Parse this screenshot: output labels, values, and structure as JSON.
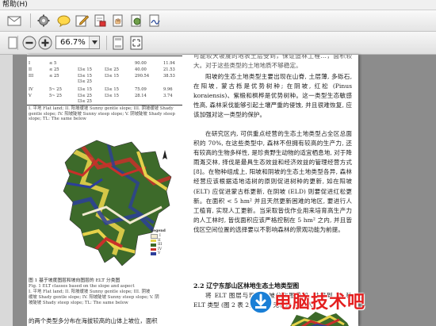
{
  "menubar": {
    "help_menu": "帮助(H)"
  },
  "toolbar": {
    "zoom_value": "66.7%",
    "icons": [
      "mail-icon",
      "settings-icon",
      "comment-icon",
      "edit-icon",
      "document-icon",
      "hand-icon",
      "scan-icon",
      "sign-icon",
      "zoom-out-icon",
      "zoom-in-icon",
      "single-page-icon",
      "fit-page-icon"
    ]
  },
  "document": {
    "table": {
      "rows": [
        [
          "I",
          "≤ 5",
          "",
          "",
          "",
          "",
          "90.00",
          "11.94"
        ],
        [
          "II",
          "≤ 25",
          "I3≤ 15",
          "I3≤ 25",
          "40.00",
          "21.53"
        ],
        [
          "III",
          "≤ 25",
          "I3≤ 15",
          "I3≤ 15",
          "290.54",
          "38.53"
        ],
        [
          "",
          "",
          "I3≤ 25",
          "",
          "",
          ""
        ],
        [
          "IV",
          "5~ 25",
          "I3≤ 15",
          "I3≤ 15",
          "75.09",
          "9.96"
        ],
        [
          "V",
          "5~ 25",
          "I3≤ 25",
          "I3≤ 15",
          "28.14",
          "3.74"
        ],
        [
          "",
          "",
          "I3≤ 25",
          "",
          "",
          ""
        ]
      ],
      "note": "I. 平地 Flat land; II. 阳坡缓坡 Sunny gentle slope; III. 阴坡缓坡 Shady gentle slope; IV. 阳坡陡坡 Sunny steep slope; V. 阴坡陡坡 Shady steep slope; TL: The same below"
    },
    "map_legend": {
      "title": "Legend",
      "items": [
        "I",
        "II",
        "III",
        "IV",
        "V"
      ]
    },
    "figure_caption": {
      "title": "图 1  基于坡度图层和坡向图层的 ELT 分类图",
      "en_title": "Fig. 1  ELT classes based on the slope and aspect",
      "lines": [
        "I. 平地 Flat land; II. 阳坡缓坡 Sunny gentle slope; III. 阴坡",
        "缓坡 Shady gentle slope; IV. 阳坡陡坡 Sunny steep slope; V. 阴",
        "坡陡坡 Shady steep slope; TL: The same below"
      ]
    },
    "left_bottom_text": "的两个类型多分布在海拔较高的山体上坡位，面积",
    "right_column": {
      "top_line": "可能较大坡度的地表土层受到，保证造林工程…，面积较大。对于这些类型的土地地质不够稳定。",
      "paragraph_1": "阳坡的生态土地类型主要出现在山脊, 土层薄, 多砾石, 在阳坡, 蒙古栎是优势树种; 在阴坡, 红松 (Pinus koraiensis)、紫椴和枫桦是优势树种。这一类型生态敏感性高, 森林采伐能够引起土壤严重的侵蚀, 并且很难恢复, 应该加强对这一类型的保护。",
      "paragraph_2": "在研究区内, 可供重点经营的生态土地类型占全区总面积的 70%, 在这些类型中, 森林不但拥有较高的生产力, 还有较高的生物多样性, 是珍贵野生动物的适宜栖息地, 对于降雨溉交林, 择伐是最具生态效益和经济效益的管理经营方式 [8]。在物种组成上, 阳坡和阴坡的生态土地类型各异, 森林经营应该根据适地适树的原则促进树种的更新, 如在阳坡 (ELT) 应促进蒙古栎更新, 在阴坡 (ELD) 则要促进红松更新。在面积 < 5 hm² 并且天然更新困难的地区, 要进行人工植育, 实现人工更新。当采取皆伐作业用来培育高生产力的人工林时, 皆伐面积应该严格控制在 5 hm² 之内, 并且皆伐区空间位置的选择要以不影响森林的景观功能为前提。",
      "section_heading": "2.2  辽宁东部山区林地生态土地类型图",
      "paragraph_3": "将 ELT 图层与现存植被分布图叠加, 共得到 34 种 ELT 类型 (图 2 表 2)。其中, 无林地 5类, 人工"
    },
    "watermark": "电脑技术吧"
  }
}
